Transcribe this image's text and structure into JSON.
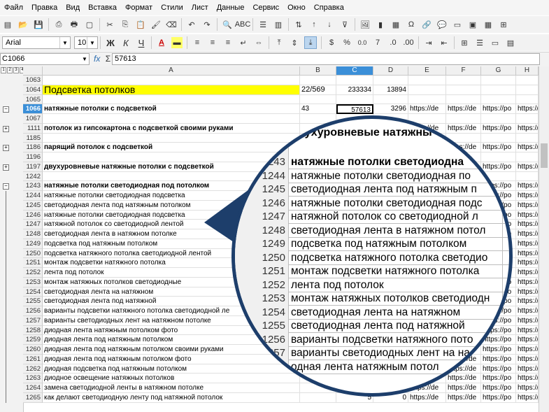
{
  "menu": [
    "Файл",
    "Правка",
    "Вид",
    "Вставка",
    "Формат",
    "Стили",
    "Лист",
    "Данные",
    "Сервис",
    "Окно",
    "Справка"
  ],
  "toolbar": {
    "font_name": "Arial",
    "font_size": "10",
    "bold": "Ж",
    "italic": "К",
    "underline": "Ч",
    "currency": "$",
    "percent": "%",
    "decimal": "0.0"
  },
  "formula": {
    "cell_ref": "C1066",
    "fx": "fx",
    "sum": "Σ",
    "eq": "=",
    "value": "57613"
  },
  "outline_levels": [
    "1",
    "2",
    "3",
    "4"
  ],
  "columns": [
    "A",
    "B",
    "C",
    "D",
    "E",
    "F",
    "G",
    "H"
  ],
  "selected_column": "C",
  "rows": [
    {
      "n": "1063",
      "a": "",
      "b": "",
      "c": "",
      "d": "",
      "links": false,
      "bold": false
    },
    {
      "n": "1064",
      "a": "Подсветка потолков",
      "b": "22/569",
      "c": "233334",
      "d": "13894",
      "links": false,
      "bold": false,
      "yellow": true
    },
    {
      "n": "1065",
      "a": "",
      "b": "",
      "c": "",
      "d": "",
      "links": false,
      "bold": false
    },
    {
      "n": "1066",
      "a": "натяжные потолки с подсветкой",
      "b": "43",
      "c": "57613",
      "d": "3296",
      "links": true,
      "bold": true,
      "selected": true
    },
    {
      "n": "1067",
      "a": "",
      "b": "",
      "c": "",
      "d": "",
      "links": false,
      "bold": false
    },
    {
      "n": "1111",
      "a": "потолок из гипсокартона с подсветкой своими руками",
      "b": "",
      "c": "",
      "d": "",
      "links": true,
      "bold": true
    },
    {
      "n": "1185",
      "a": "",
      "b": "",
      "c": "",
      "d": "",
      "links": false,
      "bold": false
    },
    {
      "n": "1186",
      "a": "парящий потолок с подсветкой",
      "b": "",
      "c": "",
      "d": "",
      "links": true,
      "bold": true
    },
    {
      "n": "1196",
      "a": "",
      "b": "",
      "c": "",
      "d": "",
      "links": false,
      "bold": false
    },
    {
      "n": "1197",
      "a": "двухуровневые натяжные потолки с подсветкой",
      "b": "",
      "c": "",
      "d": "",
      "links": true,
      "bold": true
    },
    {
      "n": "1242",
      "a": "",
      "b": "",
      "c": "",
      "d": "",
      "links": false,
      "bold": false
    },
    {
      "n": "1243",
      "a": "натяжные потолки светодиодная под потолком",
      "b": "",
      "c": "",
      "d": "",
      "links": true,
      "bold": true
    },
    {
      "n": "1244",
      "a": "натяжные потолки светодиодная подсветка",
      "b": "",
      "c": "",
      "d": "",
      "links": true,
      "bold": false
    },
    {
      "n": "1245",
      "a": "светодиодная лента под натяжным потолком",
      "b": "",
      "c": "",
      "d": "",
      "links": true,
      "bold": false
    },
    {
      "n": "1246",
      "a": "натяжные потолки светодиодная подсветка",
      "b": "",
      "c": "",
      "d": "",
      "links": true,
      "bold": false
    },
    {
      "n": "1247",
      "a": "натяжной потолок со светодиодной лентой",
      "b": "",
      "c": "",
      "d": "",
      "links": true,
      "bold": false
    },
    {
      "n": "1248",
      "a": "светодиодная лента в натяжном потолке",
      "b": "",
      "c": "",
      "d": "",
      "links": true,
      "bold": false
    },
    {
      "n": "1249",
      "a": "подсветка под натяжным потолком",
      "b": "",
      "c": "",
      "d": "",
      "links": true,
      "bold": false
    },
    {
      "n": "1250",
      "a": "подсветка натяжного потолка светодиодной лентой",
      "b": "",
      "c": "",
      "d": "",
      "links": true,
      "bold": false
    },
    {
      "n": "1251",
      "a": "монтаж подсветки натяжного потолка",
      "b": "",
      "c": "",
      "d": "",
      "links": true,
      "bold": false
    },
    {
      "n": "1252",
      "a": "лента под потолок",
      "b": "",
      "c": "",
      "d": "",
      "links": true,
      "bold": false
    },
    {
      "n": "1253",
      "a": "монтаж натяжных потолков светодиодные",
      "b": "",
      "c": "",
      "d": "",
      "links": true,
      "bold": false
    },
    {
      "n": "1254",
      "a": "светодиодная лента на натяжном",
      "b": "",
      "c": "",
      "d": "",
      "links": true,
      "bold": false
    },
    {
      "n": "1255",
      "a": "светодиодная лента под натяжной",
      "b": "",
      "c": "",
      "d": "",
      "links": true,
      "bold": false
    },
    {
      "n": "1256",
      "a": "варианты подсветки натяжного потолка светодиодной ле",
      "b": "",
      "c": "",
      "d": "",
      "links": true,
      "bold": false
    },
    {
      "n": "1257",
      "a": "варианты светодиодных лент на натяжном потолке",
      "b": "",
      "c": "",
      "d": "",
      "links": true,
      "bold": false
    },
    {
      "n": "1258",
      "a": "диодная лента натяжным потолком фото",
      "b": "",
      "c": "",
      "d": "",
      "links": true,
      "bold": false
    },
    {
      "n": "1259",
      "a": "диодная лента под натяжным потолком",
      "b": "",
      "c": "",
      "d": "",
      "links": true,
      "bold": false
    },
    {
      "n": "1260",
      "a": "диодная лента под натяжным потолком своими руками",
      "b": "",
      "c": "",
      "d": "",
      "links": true,
      "bold": false
    },
    {
      "n": "1261",
      "a": "диодная лента под натяжным потолком фото",
      "b": "",
      "c": "",
      "d": "",
      "links": true,
      "bold": false
    },
    {
      "n": "1262",
      "a": "диодная подсветка под натяжным потолком",
      "b": "",
      "c": "",
      "d": "",
      "links": true,
      "bold": false
    },
    {
      "n": "1263",
      "a": "диодное освещение натяжных потолков",
      "b": "",
      "c": "",
      "d": "",
      "links": true,
      "bold": false
    },
    {
      "n": "1264",
      "a": "замена светодиодной ленты в натяжном потолке",
      "b": "",
      "c": "10",
      "d": "0",
      "links": true,
      "bold": false
    },
    {
      "n": "1265",
      "a": "как делают светодиодную ленту под натяжной потолок",
      "b": "",
      "c": "5",
      "d": "0",
      "links": true,
      "bold": false
    }
  ],
  "link_texts": {
    "e": "https://de",
    "f": "https://de",
    "g": "https://po",
    "h": "https://"
  },
  "magnifier": {
    "top_text": "двухуровневые натяжны",
    "rows": [
      {
        "n": "1243",
        "t": "натяжные потолки светодиодна",
        "bold": true
      },
      {
        "n": "1244",
        "t": "натяжные потолки светодиодная по",
        "bold": false
      },
      {
        "n": "1245",
        "t": "светодиодная лента под натяжным п",
        "bold": false
      },
      {
        "n": "1246",
        "t": "натяжные потолки светодиодная подс",
        "bold": false
      },
      {
        "n": "1247",
        "t": "натяжной потолок со светодиодной л",
        "bold": false
      },
      {
        "n": "1248",
        "t": "светодиодная лента в натяжном потол",
        "bold": false
      },
      {
        "n": "1249",
        "t": "подсветка под натяжным потолком",
        "bold": false
      },
      {
        "n": "1250",
        "t": "подсветка натяжного потолка светодио",
        "bold": false
      },
      {
        "n": "1251",
        "t": "монтаж подсветки натяжного потолка",
        "bold": false
      },
      {
        "n": "1252",
        "t": "лента под потолок",
        "bold": false
      },
      {
        "n": "1253",
        "t": "монтаж натяжных потолков светодиодн",
        "bold": false
      },
      {
        "n": "1254",
        "t": "светодиодная лента на натяжном",
        "bold": false
      },
      {
        "n": "1255",
        "t": "светодиодная лента под натяжной",
        "bold": false
      },
      {
        "n": "1256",
        "t": "варианты подсветки натяжного пото",
        "bold": false
      },
      {
        "n": "1257",
        "t": "варианты светодиодных лент на на",
        "bold": false
      },
      {
        "n": "",
        "t": "одная лента натяжным потол",
        "bold": false
      }
    ]
  },
  "colors": {
    "accent": "#3b8fd8",
    "highlight": "#ffff00",
    "magnifier_border": "#1d3e6b"
  }
}
